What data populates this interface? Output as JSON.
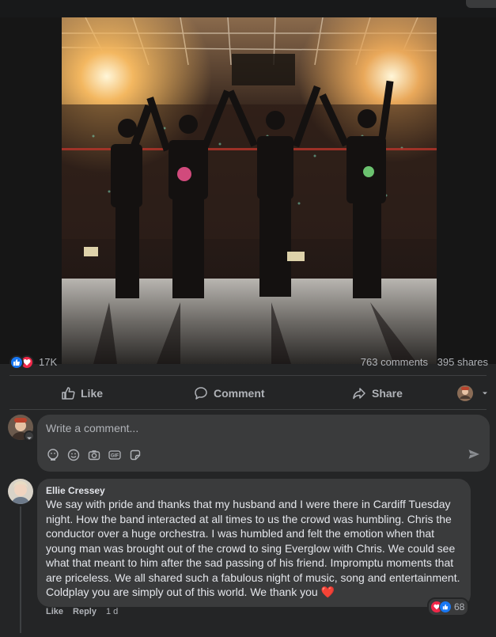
{
  "post": {
    "reactions": {
      "count": "17K",
      "types": [
        "like-icon",
        "love-icon"
      ]
    },
    "comments_count": "763 comments",
    "shares_count": "395 shares"
  },
  "actions": {
    "like": "Like",
    "comment": "Comment",
    "share": "Share"
  },
  "composer": {
    "placeholder": "Write a comment...",
    "tools": [
      "avatar-sticker-icon",
      "emoji-icon",
      "camera-icon",
      "gif-icon",
      "sticker-icon"
    ]
  },
  "comment": {
    "author": "Ellie Cressey",
    "text": "We say with pride and thanks that my husband and I were there in Cardiff Tuesday night. How the band interacted at all times to us the crowd was humbling. Chris the conductor over a huge orchestra. I was humbled and felt the emotion when that young man was brought out of the crowd to sing Everglow with Chris. We could see what that meant to him after the sad passing of his friend. Impromptu moments that are priceless. We all shared such a fabulous night of music, song and entertainment. Coldplay you are simply out of this world. We thank you ❤️",
    "reaction_count": "68",
    "like_label": "Like",
    "reply_label": "Reply",
    "time": "1 d"
  },
  "colors": {
    "accent": "#1877f2",
    "love": "#f02849",
    "bg": "#242526",
    "surface": "#3a3b3c"
  }
}
